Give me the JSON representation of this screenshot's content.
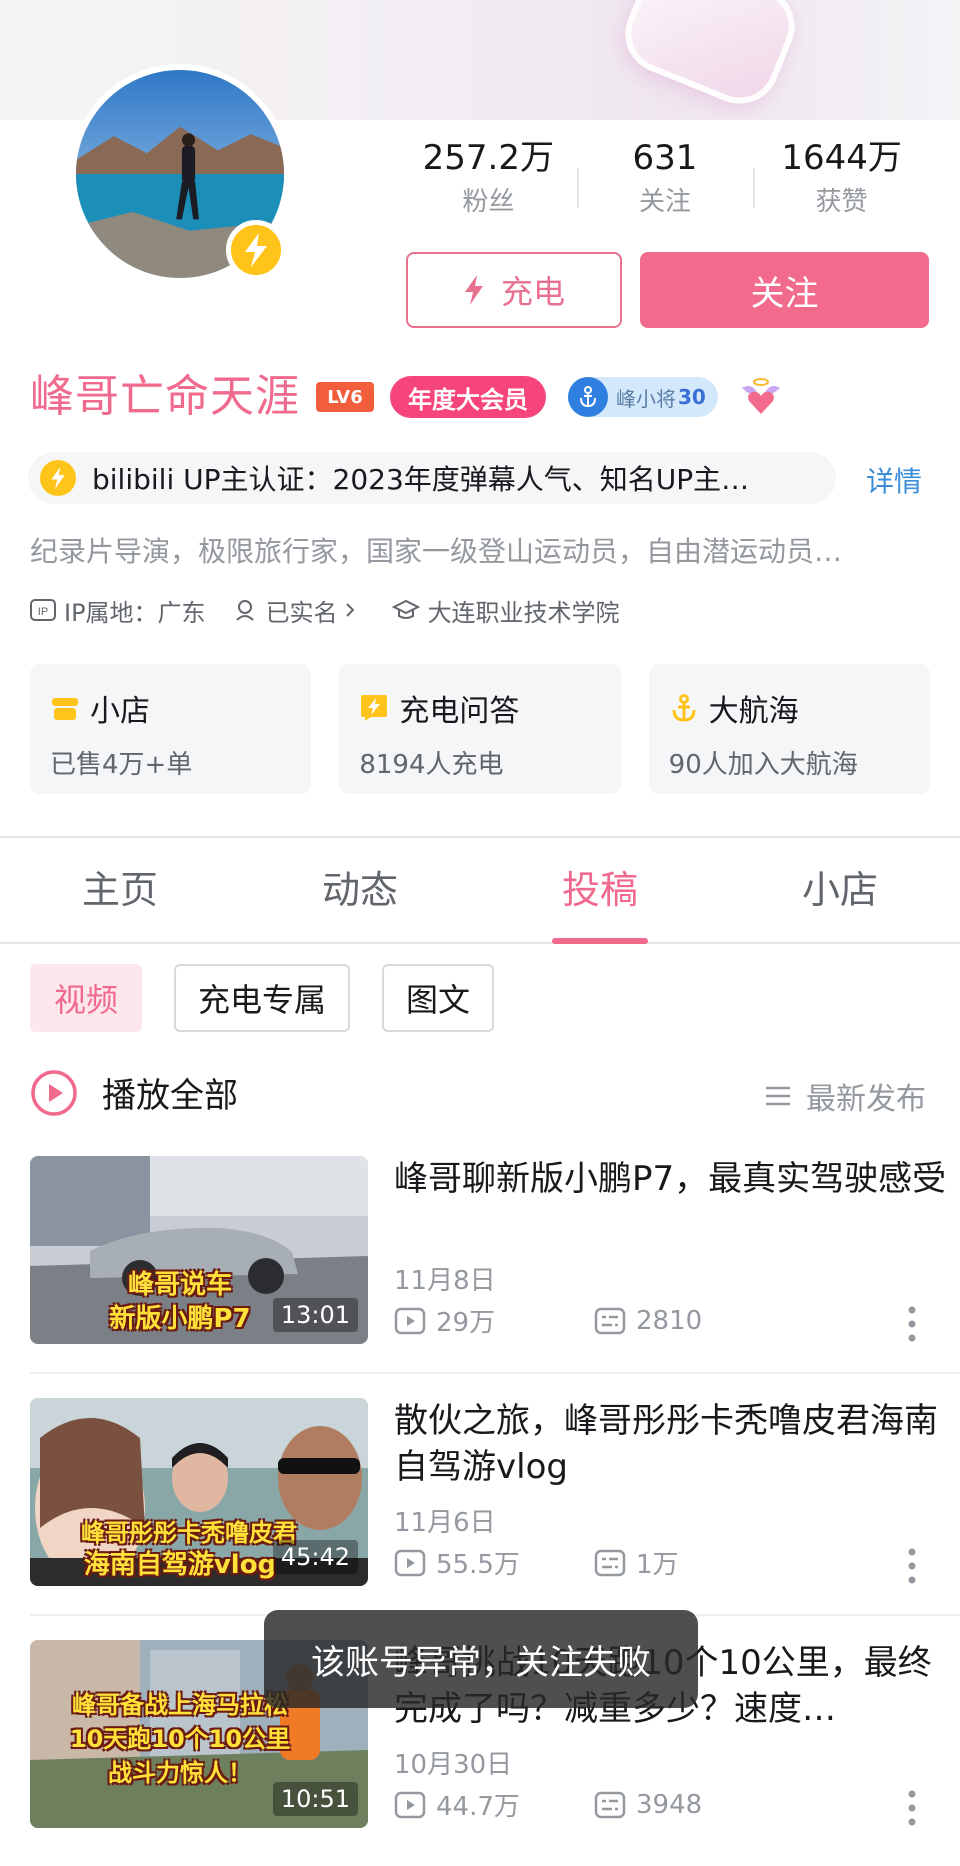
{
  "profile": {
    "username": "峰哥亡命天涯",
    "level": "LV6",
    "vip_badge": "年度大会员",
    "medal": {
      "name": "峰小将",
      "level": "30"
    },
    "certification": "bilibili UP主认证：2023年度弹幕人气、知名UP主…",
    "detail_link": "详情",
    "bio": "纪录片导演，极限旅行家，国家一级登山运动员，自由潜运动员…",
    "meta": {
      "ip": "IP属地：广东",
      "realname": "已实名",
      "school": "大连职业技术学院"
    }
  },
  "stats": [
    {
      "value": "257.2万",
      "label": "粉丝"
    },
    {
      "value": "631",
      "label": "关注"
    },
    {
      "value": "1644万",
      "label": "获赞"
    }
  ],
  "buttons": {
    "charge": "充电",
    "follow": "关注"
  },
  "cards": [
    {
      "title": "小店",
      "subtitle": "已售4万+单",
      "icon": "shop-icon"
    },
    {
      "title": "充电问答",
      "subtitle": "8194人充电",
      "icon": "charge-qa-icon"
    },
    {
      "title": "大航海",
      "subtitle": "90人加入大航海",
      "icon": "anchor-icon"
    }
  ],
  "tabs": [
    {
      "label": "主页"
    },
    {
      "label": "动态"
    },
    {
      "label": "投稿",
      "active": true
    },
    {
      "label": "小店"
    }
  ],
  "filters": [
    {
      "label": "视频",
      "active": true
    },
    {
      "label": "充电专属"
    },
    {
      "label": "图文"
    }
  ],
  "list_header": {
    "play_all": "播放全部",
    "sort": "最新发布"
  },
  "videos": [
    {
      "title": "峰哥聊新版小鹏P7，最真实驾驶感受",
      "date": "11月8日",
      "plays": "29万",
      "danmaku": "2810",
      "duration": "13:01",
      "thumb_lines": [
        "峰哥说车",
        "新版小鹏P7"
      ]
    },
    {
      "title": "散伙之旅，峰哥彤彤卡秃噜皮君海南自驾游vlog",
      "date": "11月6日",
      "plays": "55.5万",
      "danmaku": "1万",
      "duration": "45:42",
      "thumb_lines": [
        "峰哥彤彤卡秃噜皮君",
        "海南自驾游vlog"
      ]
    },
    {
      "title": "峰哥挑战10天跑10个10公里，最终完成了吗？减重多少？速度…",
      "date": "10月30日",
      "plays": "44.7万",
      "danmaku": "3948",
      "duration": "10:51",
      "thumb_lines": [
        "峰哥备战上海马拉松",
        "10天跑10个10公里",
        "战斗力惊人！"
      ]
    }
  ],
  "toast": "该账号异常，关注失败",
  "colors": {
    "accent": "#f06a8e",
    "follow_bg": "#f26b8d",
    "link": "#3a8ed7",
    "badge_yellow": "#ffc419"
  }
}
